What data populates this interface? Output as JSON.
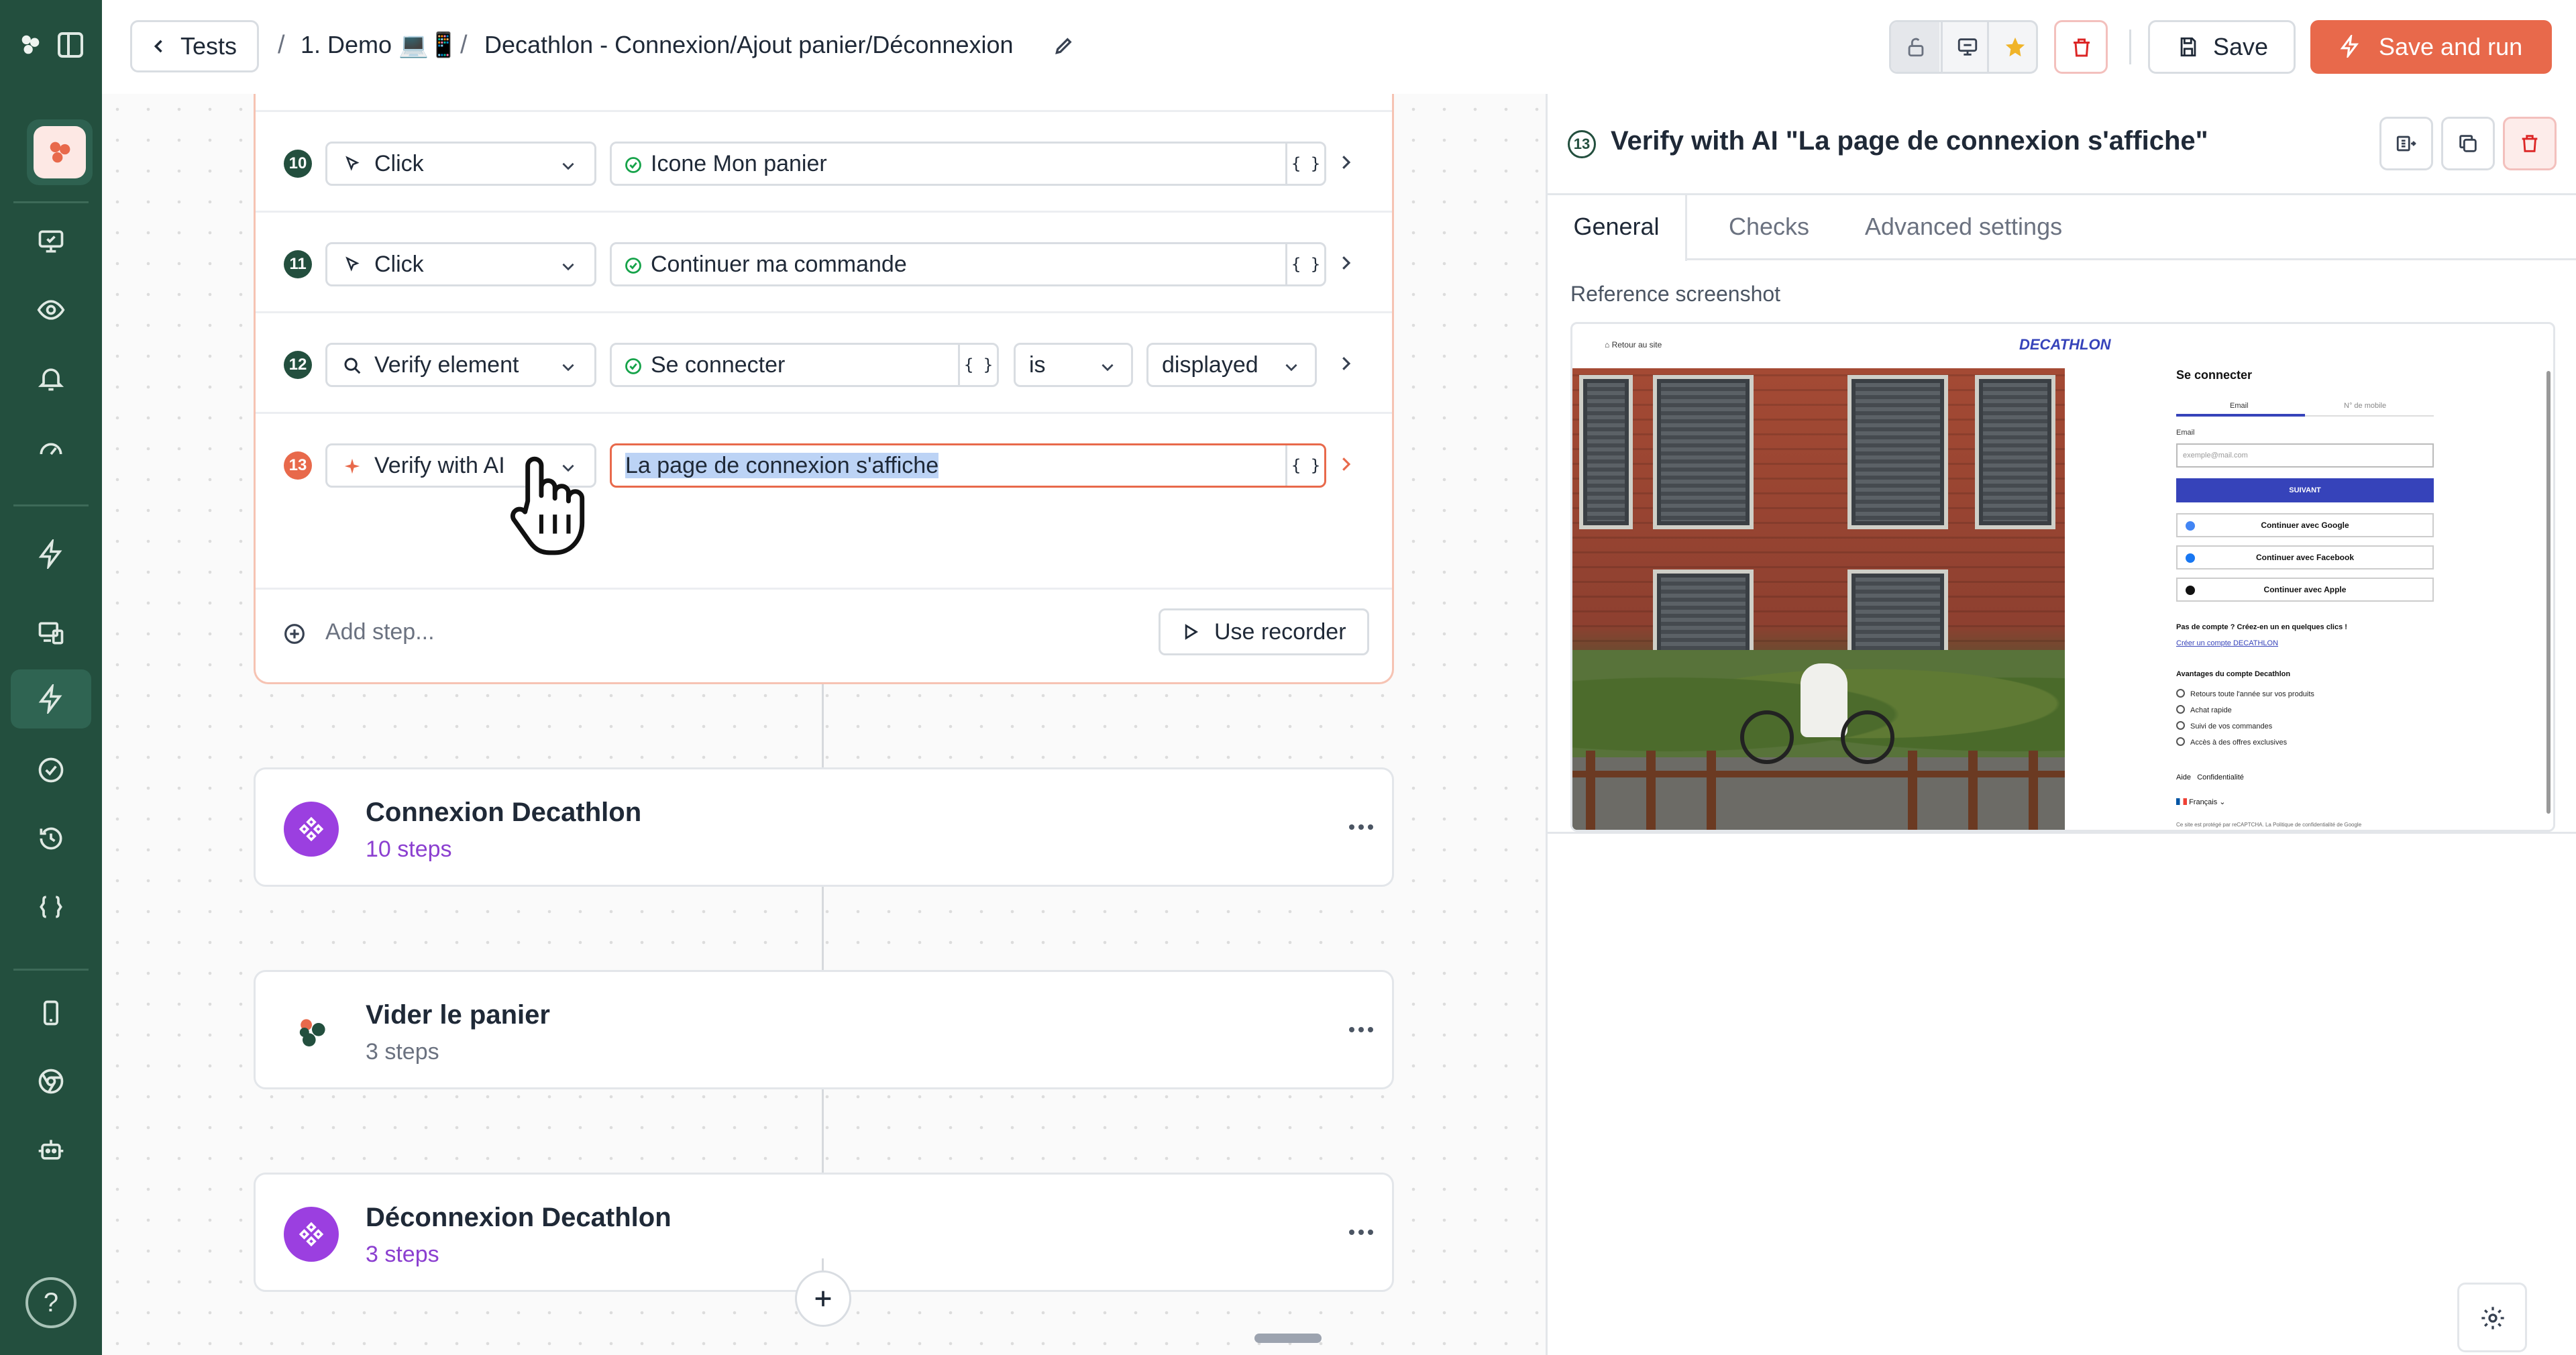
{
  "header": {
    "back_label": "Tests",
    "crumb_sep": "/",
    "crumb_folder": "1. Demo 💻📱",
    "crumb_test": "Decathlon - Connexion/Ajout panier/Déconnexion",
    "save_label": "Save",
    "run_label": "Save and run"
  },
  "steps": [
    {
      "num": "10",
      "action": "Click",
      "target": "Icone Mon panier",
      "brace": "{ }"
    },
    {
      "num": "11",
      "action": "Click",
      "target": "Continuer ma commande",
      "brace": "{ }"
    },
    {
      "num": "12",
      "action": "Verify element",
      "target": "Se connecter",
      "brace": "{ }",
      "operator": "is",
      "state": "displayed"
    },
    {
      "num": "13",
      "action": "Verify with AI",
      "target": "La page de connexion s'affiche",
      "brace": "{ }"
    }
  ],
  "add_step_label": "Add step...",
  "use_recorder_label": "Use recorder",
  "groups": [
    {
      "title": "Connexion Decathlon",
      "subtitle": "10 steps"
    },
    {
      "title": "Vider le panier",
      "subtitle": "3 steps"
    },
    {
      "title": "Déconnexion Decathlon",
      "subtitle": "3 steps"
    }
  ],
  "sidebar": {
    "help_label": "?"
  },
  "panel": {
    "step_num": "13",
    "title": "Verify with AI \"La page de connexion s'affiche\"",
    "tabs": [
      "General",
      "Checks",
      "Advanced settings"
    ],
    "active_tab": "General",
    "reference_label": "Reference screenshot"
  },
  "reference": {
    "back": "Retour au site",
    "logo": "DECATHLON",
    "title": "Se connecter",
    "tab_email": "Email",
    "tab_mobile": "N° de mobile",
    "email_label": "Email",
    "email_placeholder": "exemple@mail.com",
    "submit": "SUIVANT",
    "google": "Continuer avec Google",
    "facebook": "Continuer avec Facebook",
    "apple": "Continuer avec Apple",
    "no_account": "Pas de compte ? Créez-en un en quelques clics !",
    "create": "Créer un compte DECATHLON",
    "advantages": "Avantages du compte Decathlon",
    "benefits": [
      "Retours toute l'année sur vos produits",
      "Achat rapide",
      "Suivi de vos commandes",
      "Accès à des offres exclusives"
    ],
    "aide": "Aide",
    "conf": "Confidentialité",
    "lang": "Français",
    "legal": "Ce site est protégé par reCAPTCHA. La Politique de confidentialité de Google"
  },
  "colors": {
    "sidebar": "#234f3e",
    "accent": "#e8694b",
    "group": "#9b3fe0"
  }
}
